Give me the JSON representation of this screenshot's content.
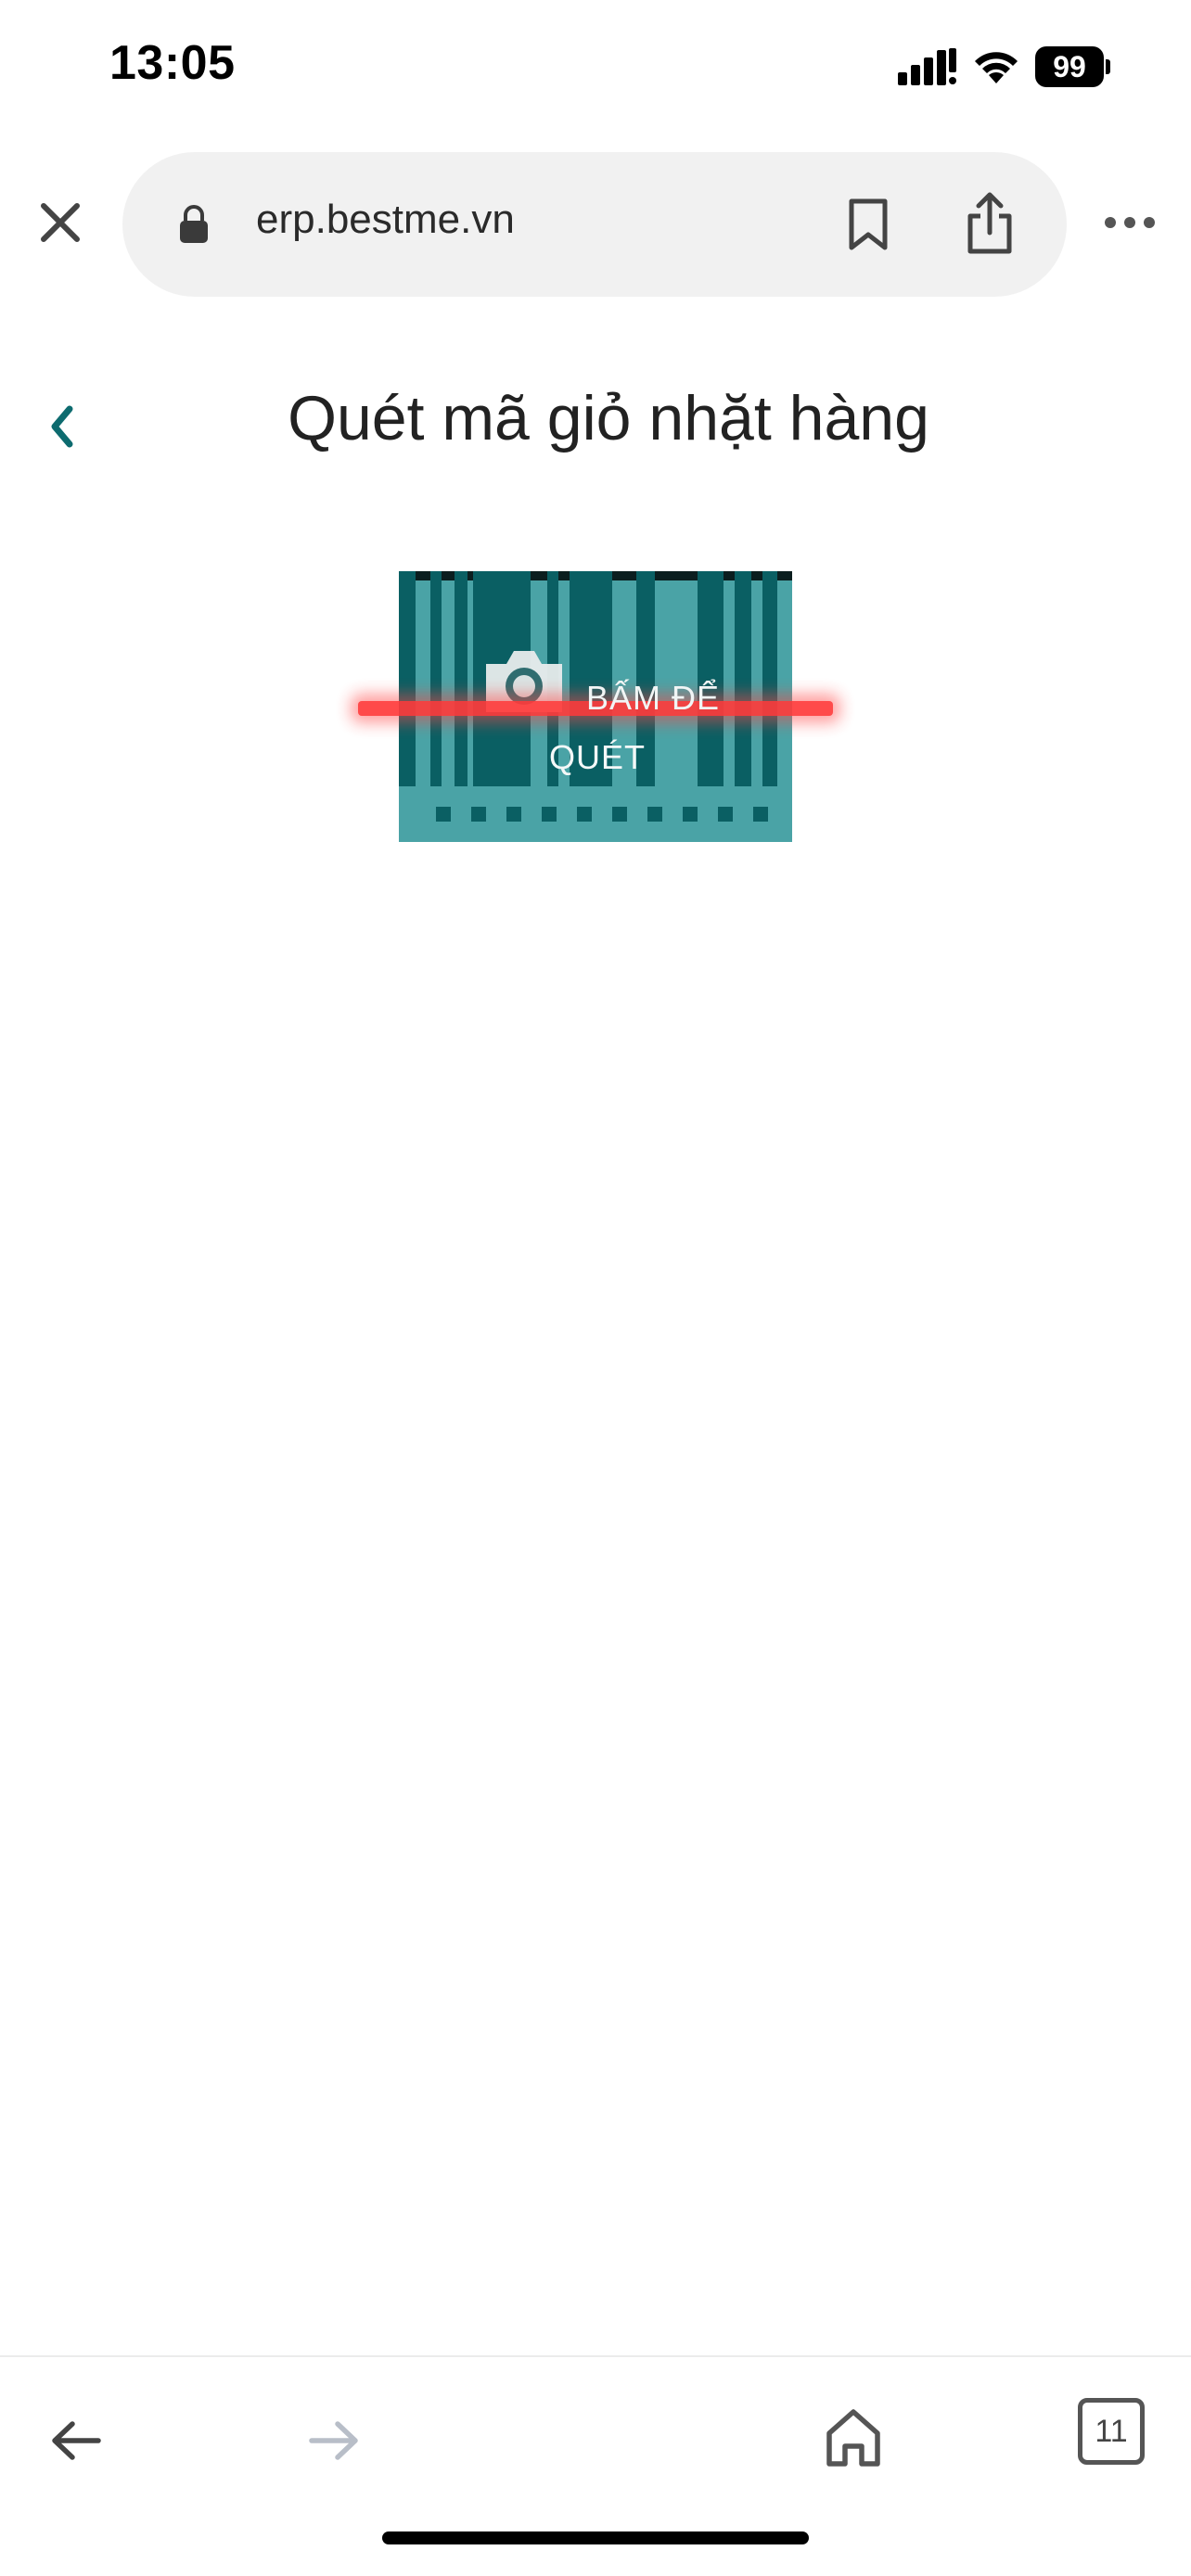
{
  "status_bar": {
    "time": "13:05",
    "battery": "99",
    "icons": [
      "signal-icon",
      "wifi-icon",
      "battery-icon"
    ]
  },
  "browser": {
    "url": "erp.bestme.vn",
    "icons": [
      "close-icon",
      "lock-icon",
      "bookmark-icon",
      "share-icon",
      "more-icon"
    ]
  },
  "page": {
    "title": "Quét mã giỏ nhặt hàng",
    "back_icon": "chevron-left-icon",
    "accent_color": "#0d6b6f"
  },
  "scanner": {
    "label_line1": "BẤM ĐỂ",
    "label_line2": "QUÉT",
    "icon": "camera-icon",
    "colors": {
      "dark": "#0a5f63",
      "light": "#4aa3a6",
      "scan_line": "#ff3b3b"
    }
  },
  "toolbar": {
    "tab_count": "11",
    "icons": [
      "back-arrow-icon",
      "forward-arrow-icon",
      "home-icon",
      "tabs-icon"
    ]
  }
}
